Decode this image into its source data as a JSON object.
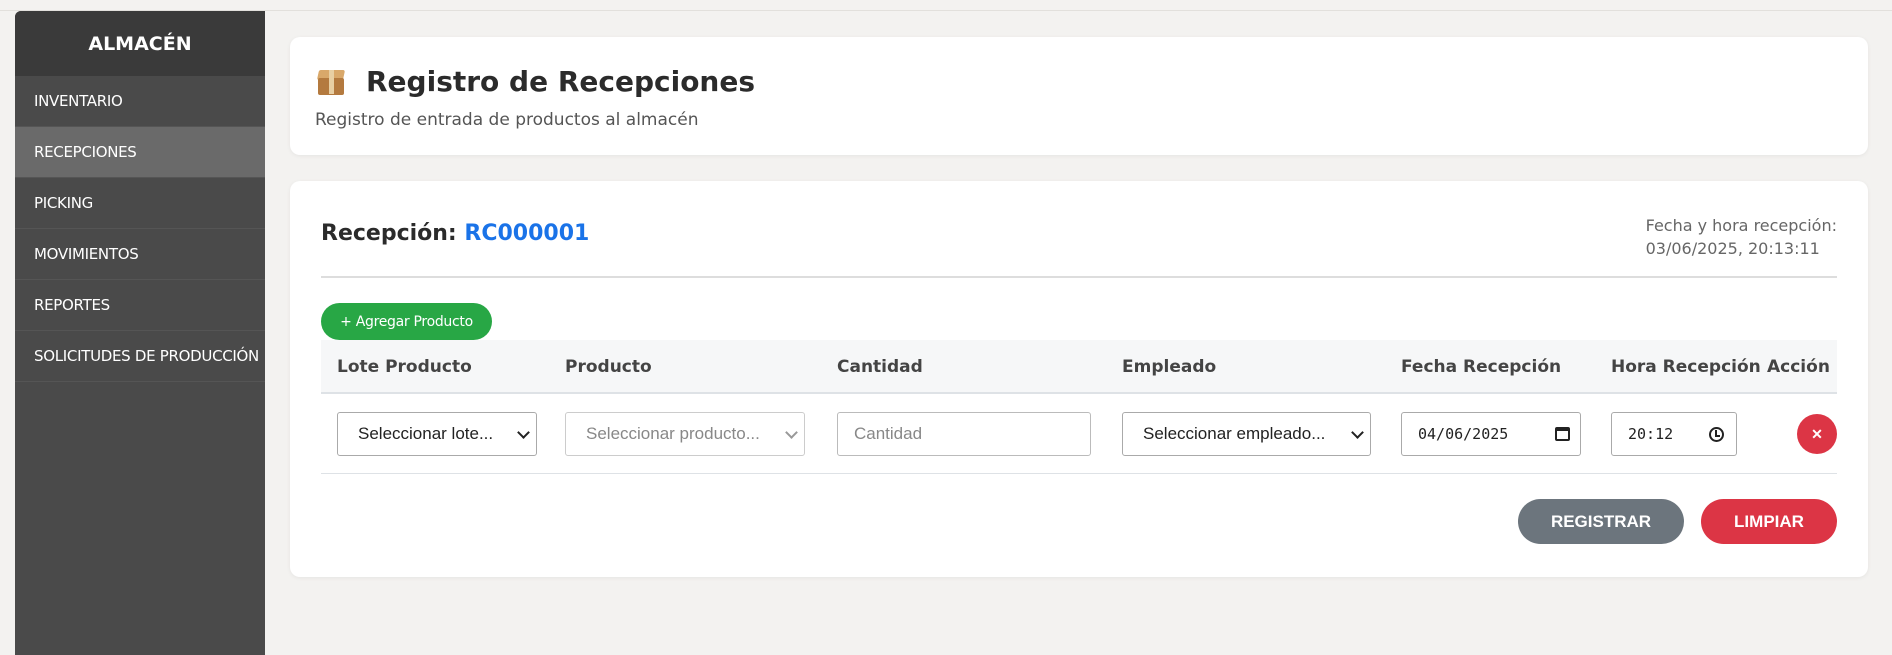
{
  "sidebar": {
    "brand": "ALMACÉN",
    "items": [
      {
        "label": "INVENTARIO"
      },
      {
        "label": "RECEPCIONES"
      },
      {
        "label": "PICKING"
      },
      {
        "label": "MOVIMIENTOS"
      },
      {
        "label": "REPORTES"
      },
      {
        "label": "SOLICITUDES DE PRODUCCIÓN"
      }
    ],
    "active_index": 1
  },
  "header": {
    "title": "Registro de Recepciones",
    "subtitle": "Registro de entrada de productos al almacén",
    "icon": "package-box-icon"
  },
  "reception": {
    "label": "Recepción:",
    "code": "RC000001",
    "datetime_label": "Fecha y hora recepción:",
    "datetime_value": "03/06/2025, 20:13:11"
  },
  "add_product_label": "+ Agregar Producto",
  "table": {
    "headers": [
      "Lote Producto",
      "Producto",
      "Cantidad",
      "Empleado",
      "Fecha Recepción",
      "Hora Recepción",
      "Acción"
    ],
    "rows": [
      {
        "lote": "Seleccionar lote...",
        "producto": "Seleccionar producto...",
        "cantidad_placeholder": "Cantidad",
        "empleado": "Seleccionar empleado...",
        "fecha": "04/06/2025",
        "hora": "20:12",
        "delete_label": "✕"
      }
    ]
  },
  "actions": {
    "register": "REGISTRAR",
    "clear": "LIMPIAR"
  },
  "colors": {
    "sidebar": "#4a4a4a",
    "accent_blue": "#1a73e8",
    "success": "#28a745",
    "danger": "#dc3545",
    "secondary": "#6c757d"
  }
}
